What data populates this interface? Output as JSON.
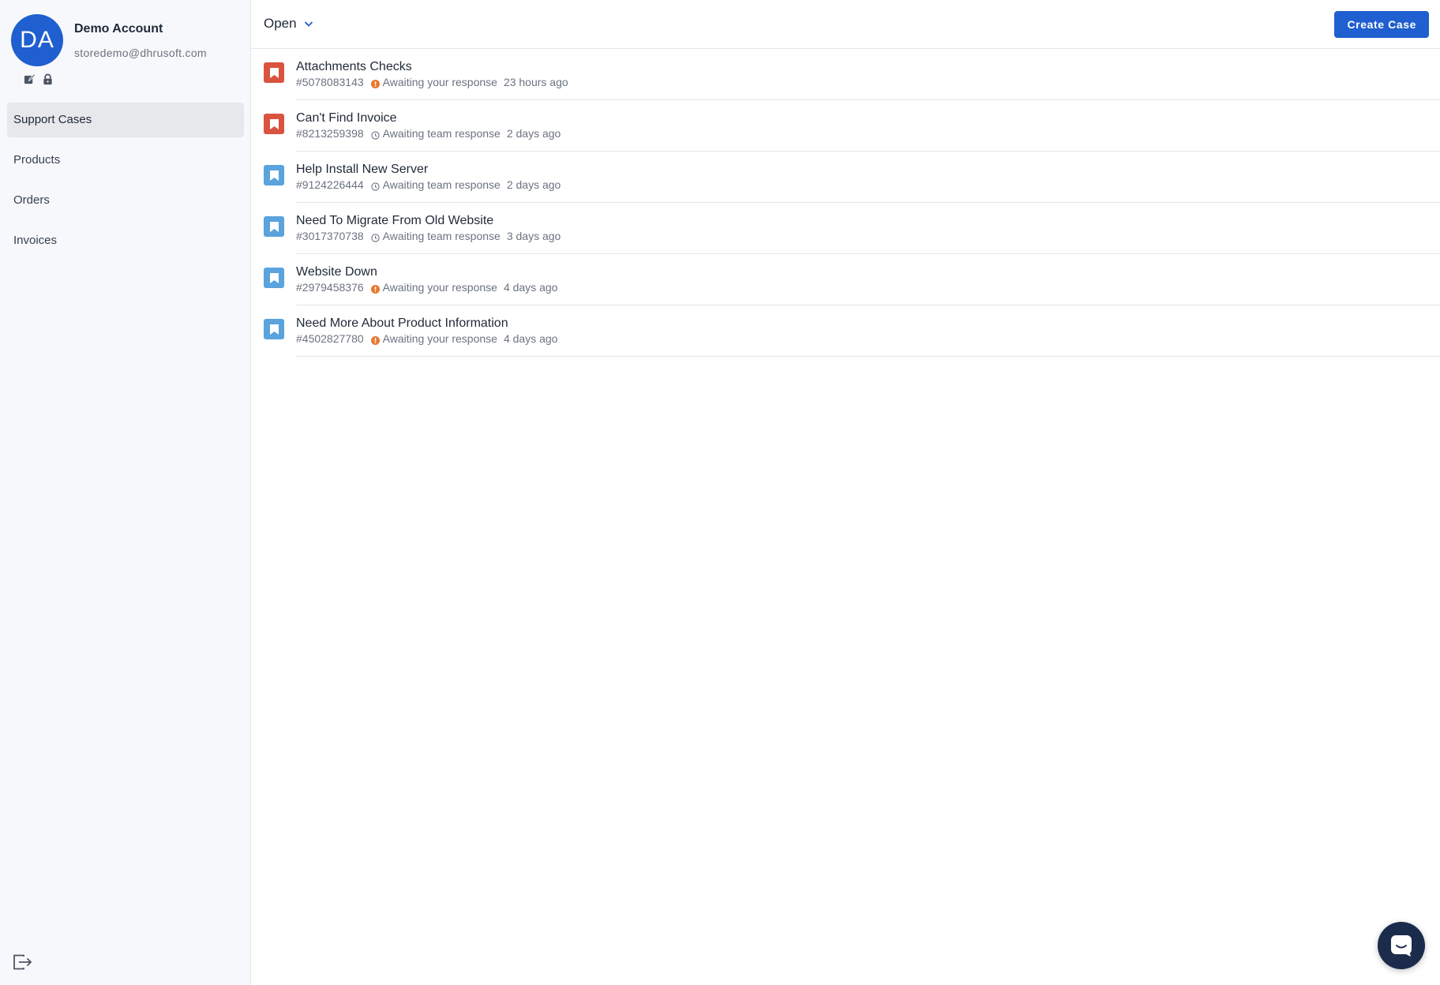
{
  "profile": {
    "initials": "DA",
    "name": "Demo Account",
    "email": "storedemo@dhrusoft.com",
    "actions": [
      {
        "icon": "edit-icon"
      },
      {
        "icon": "lock-icon"
      }
    ]
  },
  "sidebar": {
    "items": [
      {
        "label": "Support Cases",
        "active": true
      },
      {
        "label": "Products",
        "active": false
      },
      {
        "label": "Orders",
        "active": false
      },
      {
        "label": "Invoices",
        "active": false
      }
    ],
    "logout_icon": "logout-icon"
  },
  "header": {
    "filter_label": "Open",
    "create_label": "Create Case"
  },
  "colors": {
    "accent": "#1f5fcf",
    "priority_high": "#d9533f",
    "priority_normal": "#5aa3dd",
    "status_waiting_you": "#e8772e",
    "chat_launcher": "#1b2b4b"
  },
  "cases": [
    {
      "title": "Attachments Checks",
      "id": "#5078083143",
      "status": "Awaiting your response",
      "status_type": "alert",
      "time": "23 hours ago",
      "priority": "high"
    },
    {
      "title": "Can't Find Invoice",
      "id": "#8213259398",
      "status": "Awaiting team response",
      "status_type": "clock",
      "time": "2 days ago",
      "priority": "high"
    },
    {
      "title": "Help Install New Server",
      "id": "#9124226444",
      "status": "Awaiting team response",
      "status_type": "clock",
      "time": "2 days ago",
      "priority": "normal"
    },
    {
      "title": "Need To Migrate From Old Website",
      "id": "#3017370738",
      "status": "Awaiting team response",
      "status_type": "clock",
      "time": "3 days ago",
      "priority": "normal"
    },
    {
      "title": "Website Down",
      "id": "#2979458376",
      "status": "Awaiting your response",
      "status_type": "alert",
      "time": "4 days ago",
      "priority": "normal"
    },
    {
      "title": "Need More About Product Information",
      "id": "#4502827780",
      "status": "Awaiting your response",
      "status_type": "alert",
      "time": "4 days ago",
      "priority": "normal"
    }
  ]
}
